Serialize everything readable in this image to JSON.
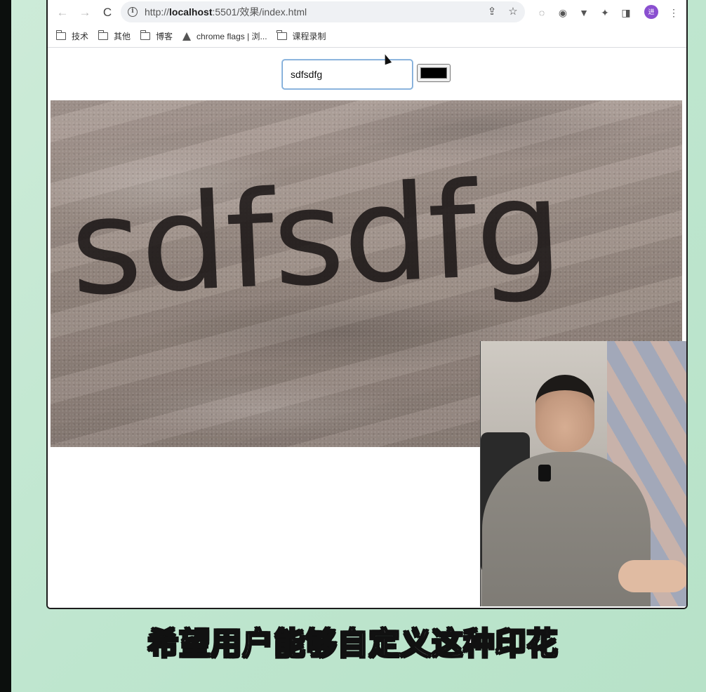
{
  "browser": {
    "url_prefix": "http://",
    "url_host": "localhost",
    "url_path": ":5501/效果/index.html",
    "nav": {
      "back": "←",
      "forward": "→",
      "reload": "C"
    },
    "toolbar_icons": [
      "share-icon",
      "star-icon",
      "extension-icon",
      "extension-icon",
      "extension-icon",
      "puzzle-icon",
      "sidebar-icon"
    ],
    "profile_initial": "进",
    "menu_glyph": "⋮"
  },
  "bookmarks": [
    {
      "label": "技术",
      "icon": "folder-icon"
    },
    {
      "label": "其他",
      "icon": "folder-icon"
    },
    {
      "label": "博客",
      "icon": "folder-icon"
    },
    {
      "label": "chrome flags | 浏...",
      "icon": "flask-icon"
    },
    {
      "label": "课程录制",
      "icon": "folder-icon"
    }
  ],
  "page": {
    "text_input_value": "sdfsdfg",
    "color_value": "#000000",
    "print_text": "sdfsdfg"
  },
  "subtitle": "希望用户能够自定义这种印花"
}
